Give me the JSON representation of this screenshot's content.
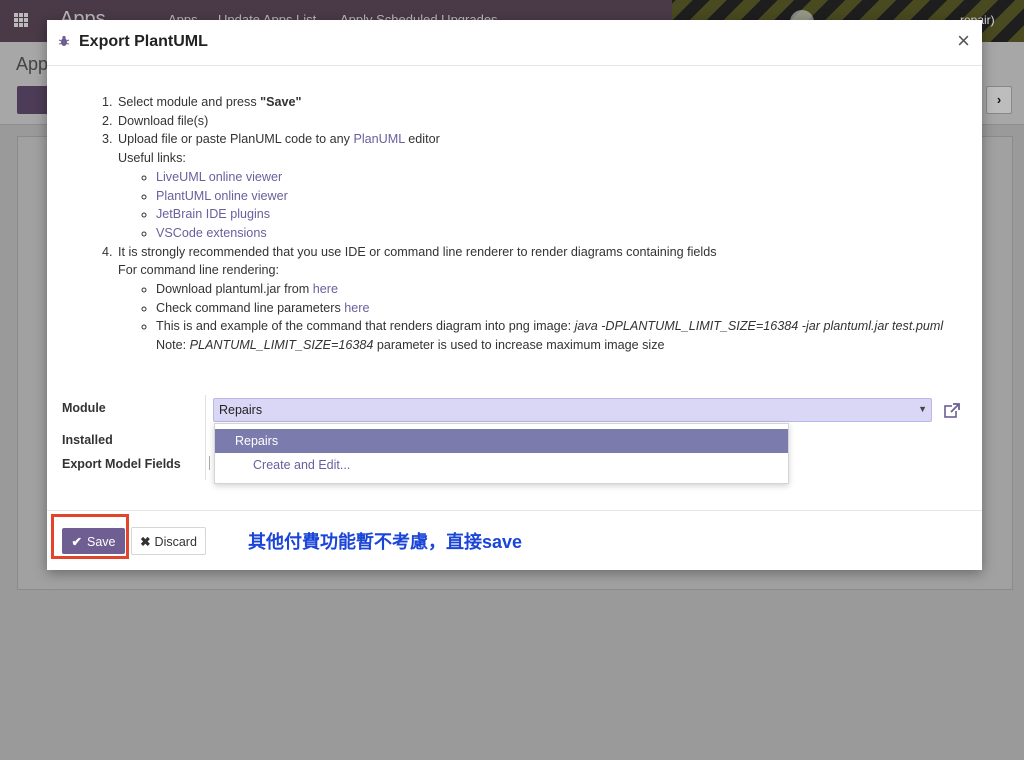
{
  "background": {
    "brand": "Apps",
    "menu": [
      "Apps",
      "Update Apps List",
      "Apply Scheduled Upgrades"
    ],
    "page_title": "Apps",
    "pager_next": "›",
    "repair_text": "repair)"
  },
  "modal": {
    "title": "Export PlantUML",
    "close": "×",
    "steps": {
      "s1_text": "Select module and press ",
      "s1_bold": "\"Save\"",
      "s2": "Download file(s)",
      "s3_pre": "Upload file or paste PlanUML code to any ",
      "s3_link": "PlanUML",
      "s3_post": " editor",
      "useful_links": "Useful links:",
      "links": [
        "LiveUML online viewer",
        "PlantUML online viewer",
        "JetBrain IDE plugins",
        "VSCode extensions"
      ],
      "s4": "It is strongly recommended that you use IDE or command line renderer to render diagrams containing fields",
      "cmd_label": "For command line rendering:",
      "cmd1_pre": "Download plantuml.jar from ",
      "cmd1_link": "here",
      "cmd2_pre": "Check command line parameters ",
      "cmd2_link": "here",
      "cmd3_pre": "This is and example of the command that renders diagram into png image: ",
      "cmd3_code": "java -DPLANTUML_LIMIT_SIZE=16384 -jar plantuml.jar test.puml",
      "note_pre": "Note: ",
      "note_code": "PLANTUML_LIMIT_SIZE=16384",
      "note_post": " parameter is used to increase maximum image size"
    },
    "form": {
      "module_label": "Module",
      "module_value": "Repairs",
      "installed_label": "Installed",
      "export_fields_label": "Export Model Fields",
      "dropdown": {
        "options": [
          "Repairs"
        ],
        "create_edit": "Create and Edit..."
      }
    },
    "footer": {
      "save_label": "Save",
      "discard_label": "Discard"
    }
  },
  "annotation": {
    "text": "其他付費功能暫不考慮，直接save",
    "highlight_color": "#e2442c",
    "text_color": "#1b45d8"
  },
  "colors": {
    "primary": "#6e5e92",
    "link": "#6a5f9c",
    "dropdown_active": "#7c7bad",
    "input_bg": "#d9d6f6"
  }
}
